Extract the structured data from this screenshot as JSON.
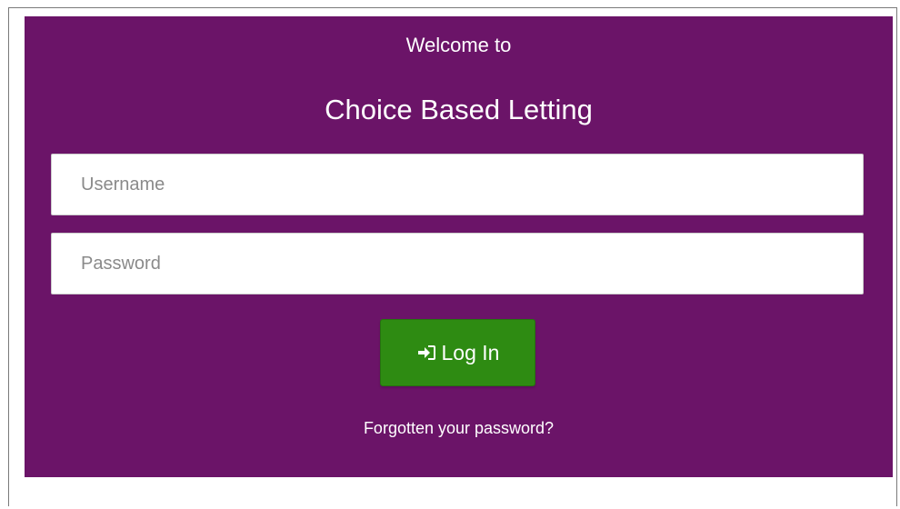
{
  "colors": {
    "panel_background": "#6b1468",
    "button_background": "#2e8b12",
    "text_on_panel": "#ffffff"
  },
  "login": {
    "welcome_text": "Welcome to",
    "title": "Choice Based Letting",
    "username_placeholder": "Username",
    "username_value": "",
    "password_placeholder": "Password",
    "password_value": "",
    "login_button_label": "Log In",
    "login_button_icon": "sign-in-icon",
    "forgot_password_link": "Forgotten your password?"
  }
}
